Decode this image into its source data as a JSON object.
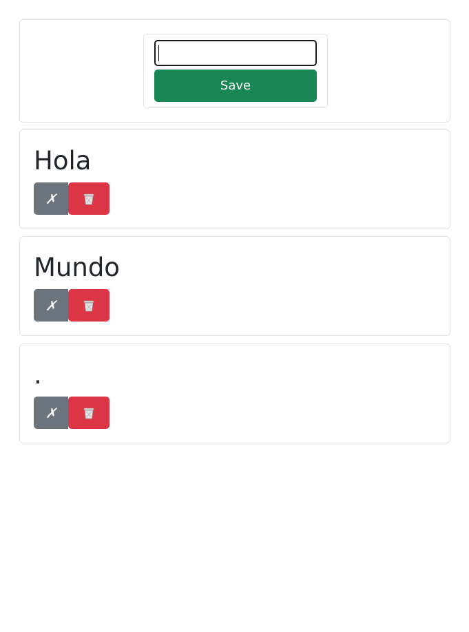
{
  "form": {
    "input_value": "",
    "save_label": "Save"
  },
  "items": [
    {
      "title": "Hola",
      "edit_label": "✗"
    },
    {
      "title": "Mundo",
      "edit_label": "✗"
    },
    {
      "title": ".",
      "edit_label": "✗"
    }
  ],
  "icons": {
    "delete": "wastebasket-icon",
    "edit": "cross-mark-icon"
  },
  "colors": {
    "save_button": "#198754",
    "edit_button": "#6c757d",
    "delete_button": "#dc3545",
    "border": "#dee2e6"
  }
}
